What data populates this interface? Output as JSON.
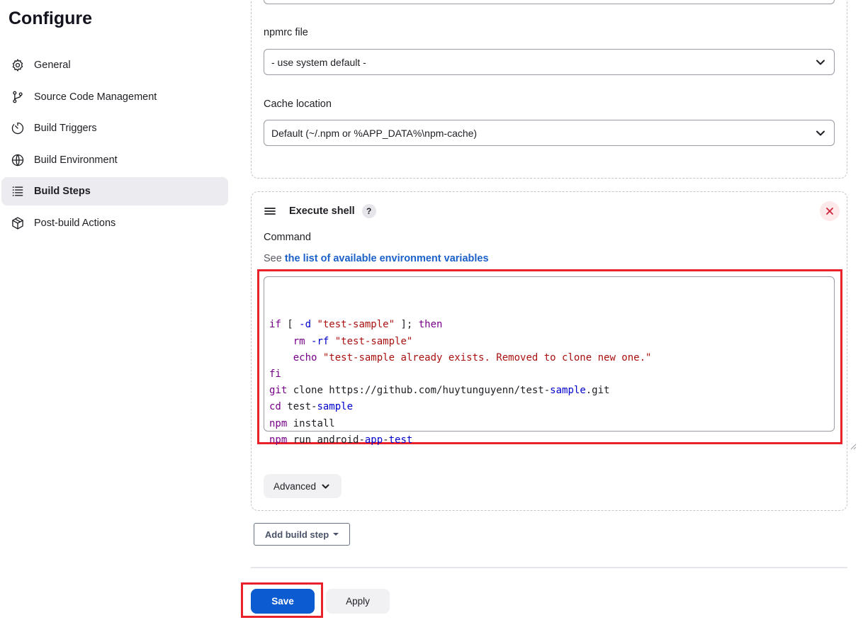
{
  "page": {
    "title": "Configure"
  },
  "sidebar": {
    "items": [
      {
        "label": "General",
        "icon": "gear-icon",
        "active": false
      },
      {
        "label": "Source Code Management",
        "icon": "git-branch-icon",
        "active": false
      },
      {
        "label": "Build Triggers",
        "icon": "timer-icon",
        "active": false
      },
      {
        "label": "Build Environment",
        "icon": "globe-icon",
        "active": false
      },
      {
        "label": "Build Steps",
        "icon": "list-icon",
        "active": true
      },
      {
        "label": "Post-build Actions",
        "icon": "package-icon",
        "active": false
      }
    ]
  },
  "npm_config": {
    "npmrc_label": "npmrc file",
    "npmrc_value": "- use system default -",
    "cache_label": "Cache location",
    "cache_value": "Default (~/.npm or %APP_DATA%\\npm-cache)"
  },
  "execute_shell": {
    "title": "Execute shell",
    "help_label": "?",
    "command_label": "Command",
    "env_prefix": "See",
    "env_link": "the list of available environment variables",
    "code_lines": [
      "if [ -d \"test-sample\" ]; then",
      "    rm -rf \"test-sample\"",
      "    echo \"test-sample already exists. Removed to clone new one.\"",
      "fi",
      "git clone https://github.com/huytunguyenn/test-sample.git",
      "cd test-sample",
      "npm install",
      "npm run android-app-test"
    ],
    "advanced_label": "Advanced"
  },
  "actions": {
    "add_build_step": "Add build step",
    "save": "Save",
    "apply": "Apply"
  },
  "colors": {
    "primary": "#0c5bd0",
    "highlight": "#e8212b",
    "link": "#1b61c9",
    "active_bg": "#ececf0"
  }
}
